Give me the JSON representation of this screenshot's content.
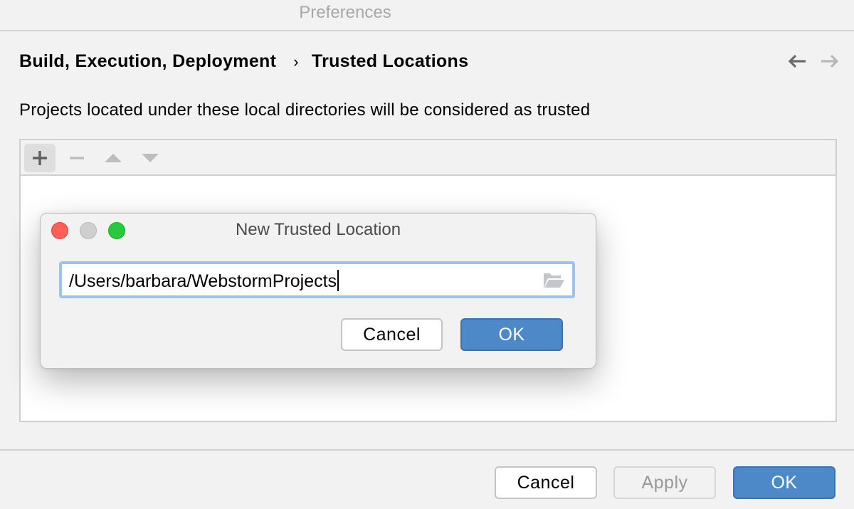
{
  "window": {
    "title": "Preferences"
  },
  "breadcrumb": {
    "parent": "Build, Execution, Deployment",
    "separator": "›",
    "current": "Trusted Locations"
  },
  "nav": {
    "back_icon": "arrow-left-icon",
    "forward_icon": "arrow-right-icon",
    "forward_enabled": false
  },
  "description": "Projects located under these local directories will be considered as trusted",
  "toolbar": {
    "add_icon": "plus-icon",
    "remove_icon": "minus-icon",
    "move_up_icon": "triangle-up-icon",
    "move_down_icon": "triangle-down-icon"
  },
  "locations": [],
  "dialog": {
    "title": "New Trusted Location",
    "path_value": "/Users/barbara/WebstormProjects",
    "browse_icon": "folder-open-icon",
    "cancel_label": "Cancel",
    "ok_label": "OK"
  },
  "footer": {
    "cancel_label": "Cancel",
    "apply_label": "Apply",
    "ok_label": "OK"
  },
  "colors": {
    "accent": "#4d89c9",
    "focus_ring": "#9cc2ef",
    "close": "#fe5f57",
    "maximize": "#28c840"
  }
}
